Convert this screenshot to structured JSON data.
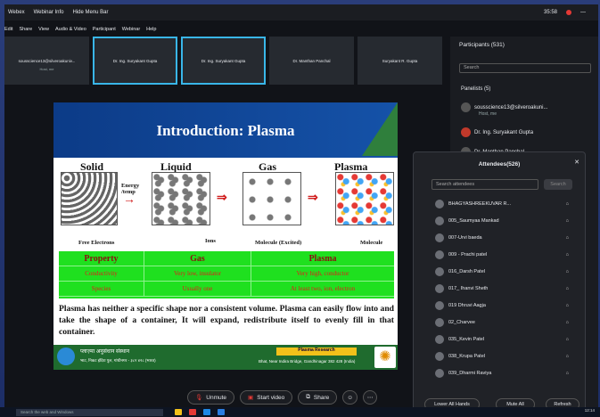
{
  "titlebar": {
    "app": "Webex",
    "info": "Webinar Info",
    "hide": "Hide Menu Bar",
    "time": "35:58"
  },
  "menu": [
    "Edit",
    "Share",
    "View",
    "Audio & Video",
    "Participant",
    "Webinar",
    "Help"
  ],
  "thumbs": [
    {
      "name": "sousscience13@silveroakuniv...",
      "sub": "Host, me"
    },
    {
      "name": "Dr. Ing. Suryakant Gupta",
      "sub": ""
    },
    {
      "name": "Dr. Ing. Suryakant Gupta",
      "sub": ""
    },
    {
      "name": "Dr. Manthan Panchal",
      "sub": ""
    },
    {
      "name": "Suryakant R. Gupta",
      "sub": ""
    }
  ],
  "slide": {
    "title": "Introduction: Plasma",
    "phases": [
      "Solid",
      "Liquid",
      "Gas",
      "Plasma"
    ],
    "energy": "Energy\n/temp",
    "labels": {
      "free_electrons": "Free Electrons",
      "ions": "Ions",
      "excited": "Molecule (Excited)",
      "molecule": "Molecule"
    },
    "table": {
      "headers": [
        "Property",
        "Gas",
        "Plasma"
      ],
      "rows": [
        [
          "Conductivity",
          "Very low, insulator",
          "Very high, conductor"
        ],
        [
          "Species",
          "Usually one",
          "At least two, ion, electron"
        ]
      ]
    },
    "paragraph": "Plasma has neither a specific shape nor a consistent volume. Plasma can easily flow into and take the shape of a container, It will expand, redistribute itself to evenly fill in that container.",
    "footer": {
      "hindi": "प्लाज़्मा अनुसंधान संस्थान",
      "hindi2": "भाट, निकट इंदिरा पुल, गांधीनगर - ३८२ ४२८ (भारत)",
      "english": "Bhat, Near Indira Bridge, Gandhinagar 382 428 (India)",
      "badge": "Plasma Research"
    }
  },
  "participants": {
    "header": "Participants (531)",
    "search": "Search",
    "panelists": "Panelists (5)",
    "list": [
      {
        "name": "sousscience13@silveroakuni...",
        "sub": "Host, me"
      },
      {
        "name": "Dr. Ing. Suryakant Gupta",
        "sub": ""
      },
      {
        "name": "Dr. Manthan Panchal",
        "sub": ""
      }
    ]
  },
  "attendees": {
    "title": "Attendees(526)",
    "search": "Search attendees",
    "search_btn": "Search",
    "list": [
      "BHAGYASHREEKUVAR R...",
      "005_Saumyaa Mankad",
      "007-Urvi baeda",
      "009 - Prachi patel",
      "016_Darsh Patel",
      "017_ Ihanvi Sheth",
      "019 Dhruvi Aagja",
      "02_Charvee",
      "035_Kevin Patel",
      "038_Krupa Patel",
      "039_Dharmi Raviya"
    ],
    "buttons": [
      "Lower All Hands",
      "Mute All",
      "Refresh"
    ]
  },
  "controls": {
    "unmute": "Unmute",
    "video": "Start video",
    "share": "Share"
  },
  "taskbar": {
    "search": "Search the web and Windows",
    "clock": "12:14"
  }
}
